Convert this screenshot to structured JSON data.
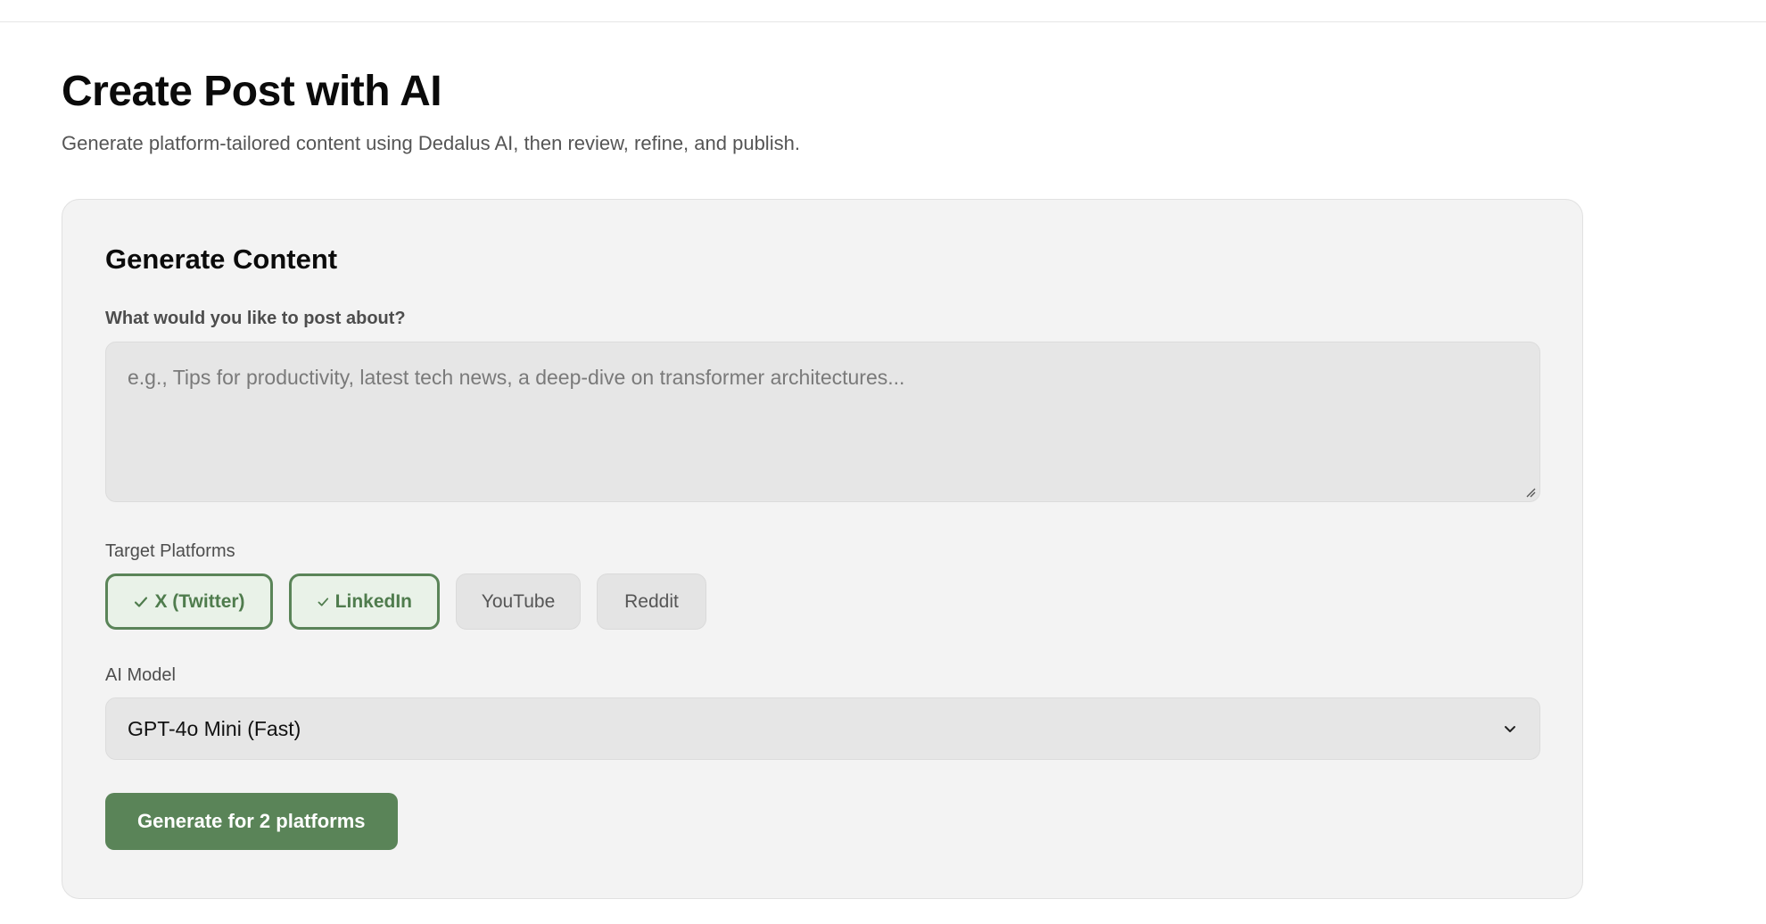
{
  "page": {
    "title": "Create Post with AI",
    "subtitle": "Generate platform-tailored content using Dedalus AI, then review, refine, and publish."
  },
  "card": {
    "title": "Generate Content",
    "prompt_label": "What would you like to post about?",
    "prompt_placeholder": "e.g., Tips for productivity, latest tech news, a deep-dive on transformer architectures...",
    "prompt_value": "",
    "platforms_label": "Target Platforms",
    "platforms": [
      {
        "label": "X (Twitter)",
        "selected": true
      },
      {
        "label": "LinkedIn",
        "selected": true
      },
      {
        "label": "YouTube",
        "selected": false
      },
      {
        "label": "Reddit",
        "selected": false
      }
    ],
    "model_label": "AI Model",
    "model_selected": "GPT-4o Mini (Fast)",
    "generate_label": "Generate for 2 platforms"
  },
  "icons": {
    "check": "check-icon",
    "chevron": "chevron-down-icon",
    "resize": "resize-grip-icon"
  },
  "colors": {
    "accent": "#5a8458",
    "accent_bg": "#e9f2e8",
    "card_bg": "#f3f3f3",
    "input_bg": "#e6e6e6"
  }
}
